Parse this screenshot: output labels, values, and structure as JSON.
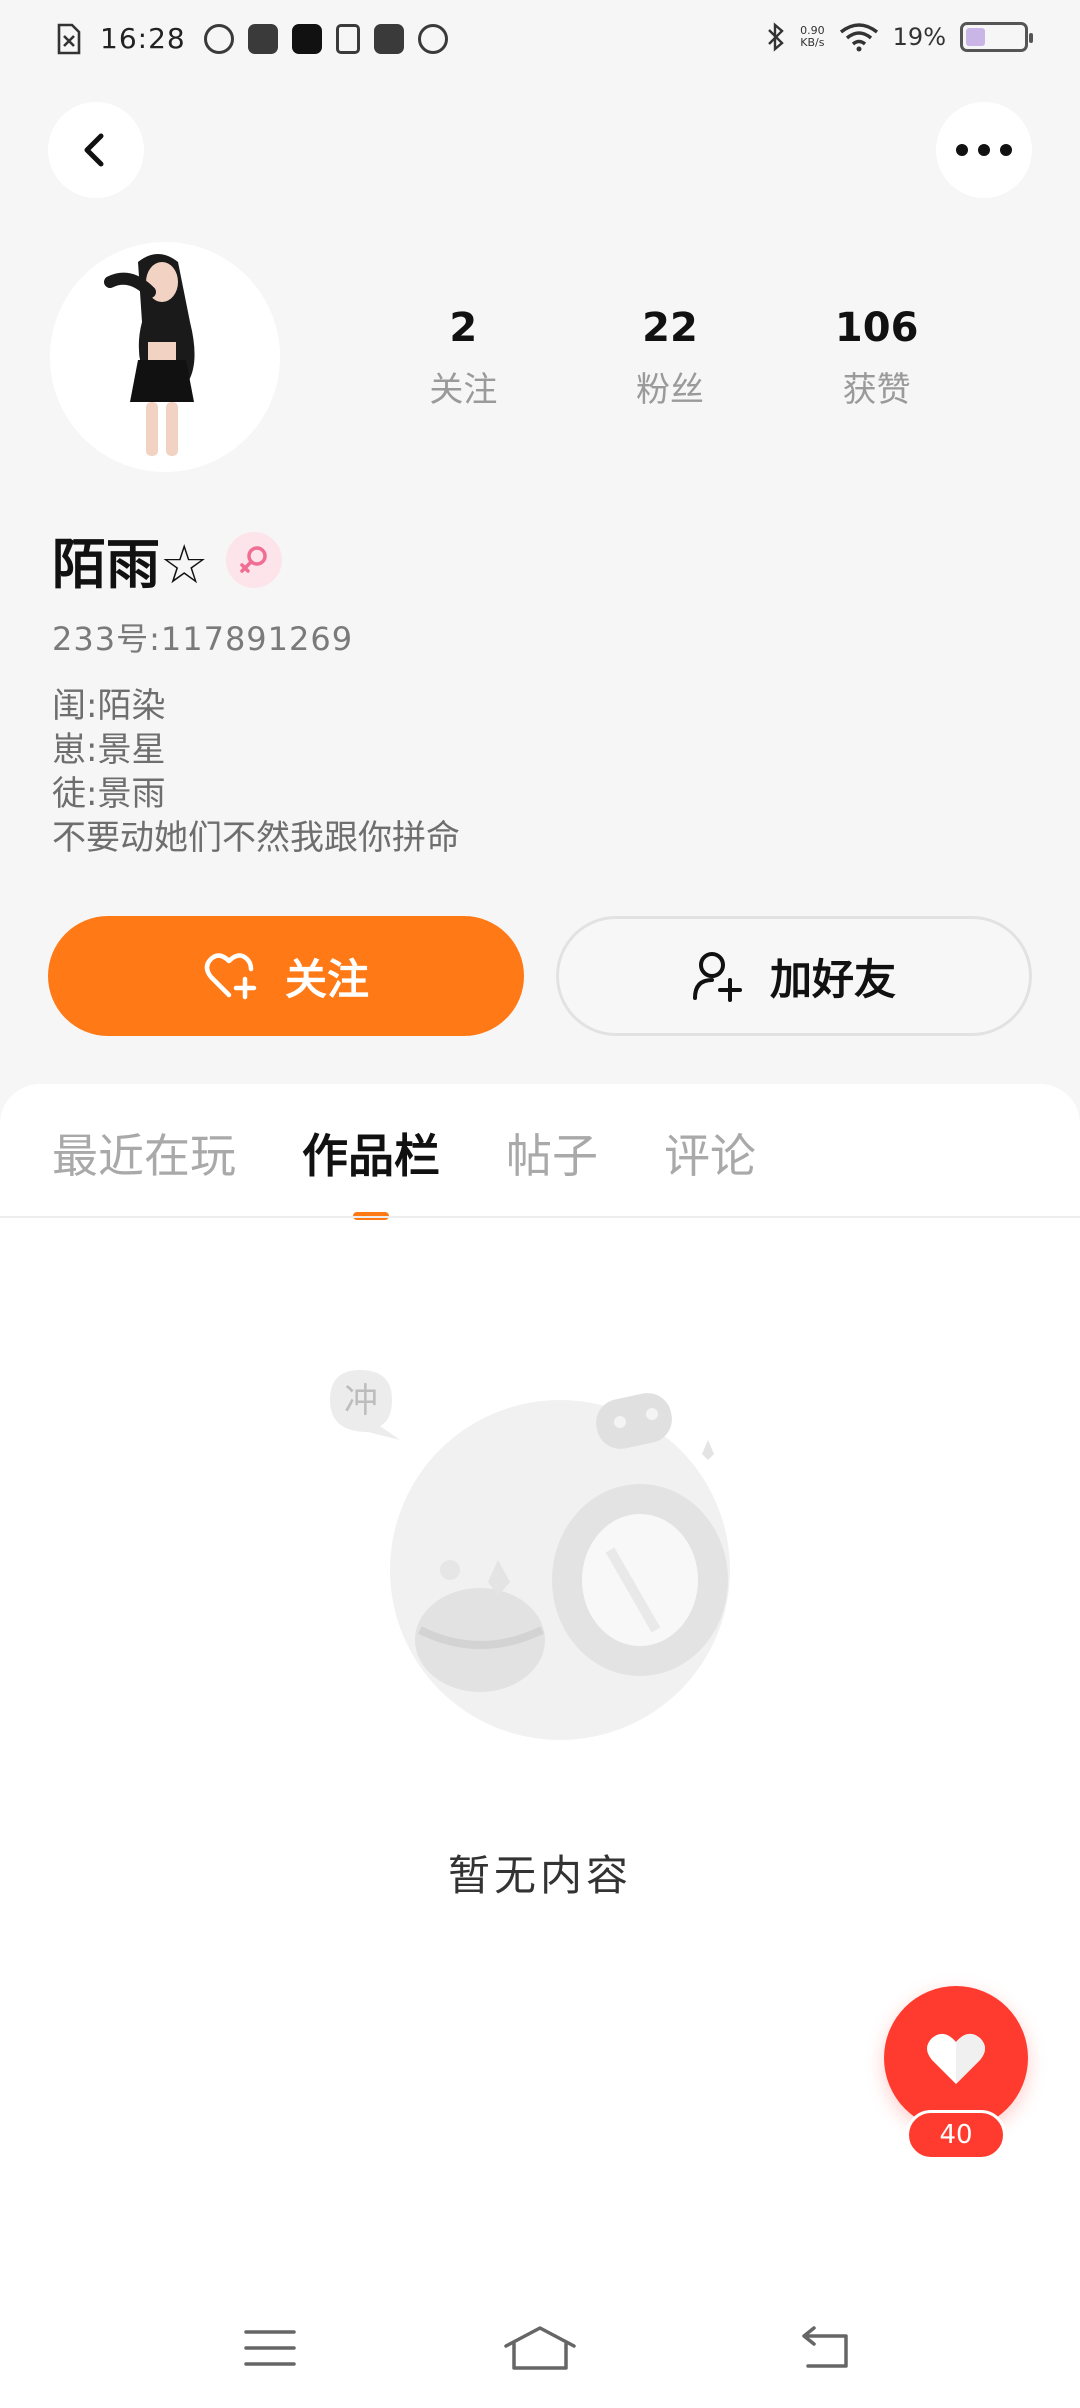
{
  "status_bar": {
    "time": "16:28",
    "net_speed_value": "0.90",
    "net_speed_unit": "KB/s",
    "battery_text": "19%",
    "battery_level": 0.19
  },
  "profile": {
    "stats": [
      {
        "value": "2",
        "label": "关注"
      },
      {
        "value": "22",
        "label": "粉丝"
      },
      {
        "value": "106",
        "label": "获赞"
      }
    ],
    "username": "陌雨☆",
    "uid": "233号:117891269",
    "bio_lines": [
      "闺:陌染",
      "崽:景星",
      "徒:景雨",
      "不要动她们不然我跟你拼命"
    ]
  },
  "actions": {
    "follow_label": "关注",
    "add_friend_label": "加好友"
  },
  "tabs": [
    {
      "label": "最近在玩",
      "active": false
    },
    {
      "label": "作品栏",
      "active": true
    },
    {
      "label": "帖子",
      "active": false
    },
    {
      "label": "评论",
      "active": false
    }
  ],
  "empty_state": {
    "bubble_text": "冲",
    "message": "暂无内容"
  },
  "like": {
    "count": "40"
  },
  "colors": {
    "accent": "#ff7a17",
    "like_red": "#ff3b2f",
    "female_pink": "#f06e93"
  }
}
